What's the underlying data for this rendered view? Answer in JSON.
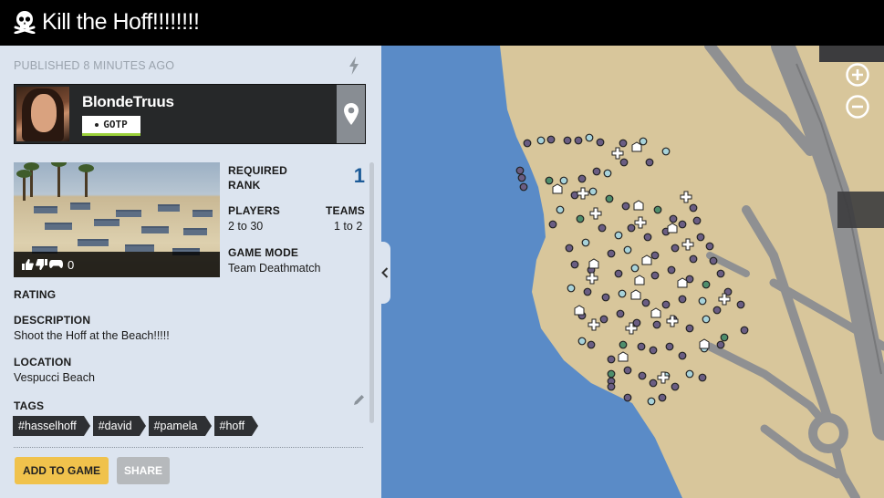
{
  "header": {
    "title": "Kill the Hoff!!!!!!!!",
    "icon": "skull-crossbones-icon"
  },
  "panel": {
    "published": "PUBLISHED 8 MINUTES AGO",
    "creator": {
      "name": "BlondeTruus",
      "crew": "GOTP",
      "crew_color": "#9bd13a"
    },
    "thumbnail_rating_count": "0",
    "required_rank_label": "REQUIRED",
    "required_rank_label2": "RANK",
    "required_rank_value": "1",
    "players_label": "PLAYERS",
    "players_value": "2 to 30",
    "teams_label": "TEAMS",
    "teams_value": "1 to 2",
    "game_mode_label": "GAME MODE",
    "game_mode_value": "Team Deathmatch",
    "rating_label": "RATING",
    "description_label": "DESCRIPTION",
    "description_value": "Shoot the Hoff at the Beach!!!!!",
    "location_label": "LOCATION",
    "location_value": "Vespucci Beach",
    "tags_label": "TAGS",
    "tags": [
      "#hasselhoff",
      "#david",
      "#pamela",
      "#hoff"
    ],
    "add_button": "ADD TO GAME",
    "share_button": "SHARE"
  },
  "colors": {
    "accent": "#f0c24c",
    "rank": "#1d5b98",
    "water": "#5a8bc7",
    "land": "#d8c69b",
    "road": "#8f9092"
  }
}
